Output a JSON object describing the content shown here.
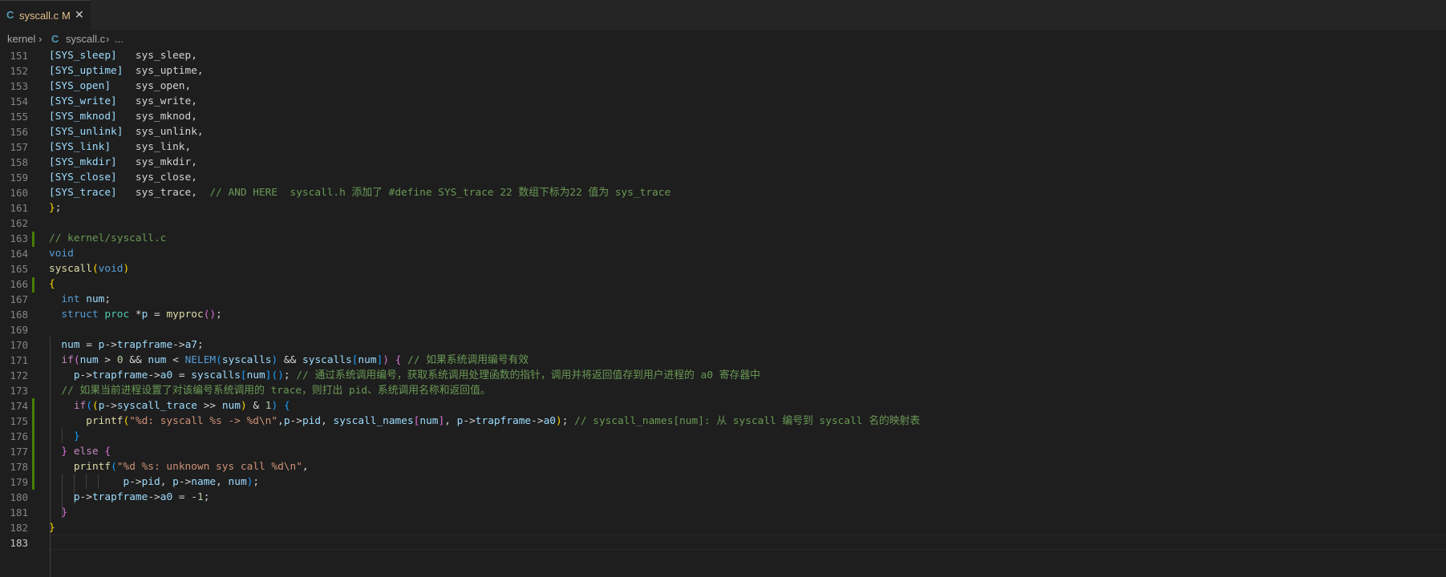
{
  "tab": {
    "icon": "C",
    "filename": "syscall.c",
    "status": "M",
    "close": "✕"
  },
  "breadcrumb": {
    "folder": "kernel",
    "file_icon": "C",
    "file": "syscall.c",
    "more": "..."
  },
  "editor": {
    "line_numbers": [
      "151",
      "152",
      "153",
      "154",
      "155",
      "156",
      "157",
      "158",
      "159",
      "160",
      "161",
      "162",
      "163",
      "164",
      "165",
      "166",
      "167",
      "168",
      "169",
      "170",
      "171",
      "172",
      "173",
      "174",
      "175",
      "176",
      "177",
      "178",
      "179",
      "180",
      "181",
      "182",
      "183"
    ],
    "syscall_table": [
      {
        "key": "[SYS_sleep]",
        "value": "sys_sleep,"
      },
      {
        "key": "[SYS_uptime]",
        "value": "sys_uptime,"
      },
      {
        "key": "[SYS_open]",
        "value": "sys_open,"
      },
      {
        "key": "[SYS_write]",
        "value": "sys_write,"
      },
      {
        "key": "[SYS_mknod]",
        "value": "sys_mknod,"
      },
      {
        "key": "[SYS_unlink]",
        "value": "sys_unlink,"
      },
      {
        "key": "[SYS_link]",
        "value": "sys_link,"
      },
      {
        "key": "[SYS_mkdir]",
        "value": "sys_mkdir,"
      },
      {
        "key": "[SYS_close]",
        "value": "sys_close,"
      },
      {
        "key": "[SYS_trace]",
        "value": "sys_trace,"
      }
    ],
    "comment_160": "// AND HERE  syscall.h 添加了 #define SYS_trace 22 数组下标为22 值为 sys_trace",
    "comment_163": "// kernel/syscall.c",
    "comment_171": "// 如果系统调用编号有效",
    "comment_172": "// 通过系统调用编号，获取系统调用处理函数的指针，调用并将返回值存到用户进程的 a0 寄存器中",
    "comment_173": "// 如果当前进程设置了对该编号系统调用的 trace，则打出 pid、系统调用名称和返回值。",
    "comment_175": "// syscall_names[num]: 从 syscall 编号到 syscall 名的映射表",
    "string_175": "\"%d: syscall %s -> %d\\n\"",
    "string_178": "\"%d %s: unknown sys call %d\\n\""
  }
}
